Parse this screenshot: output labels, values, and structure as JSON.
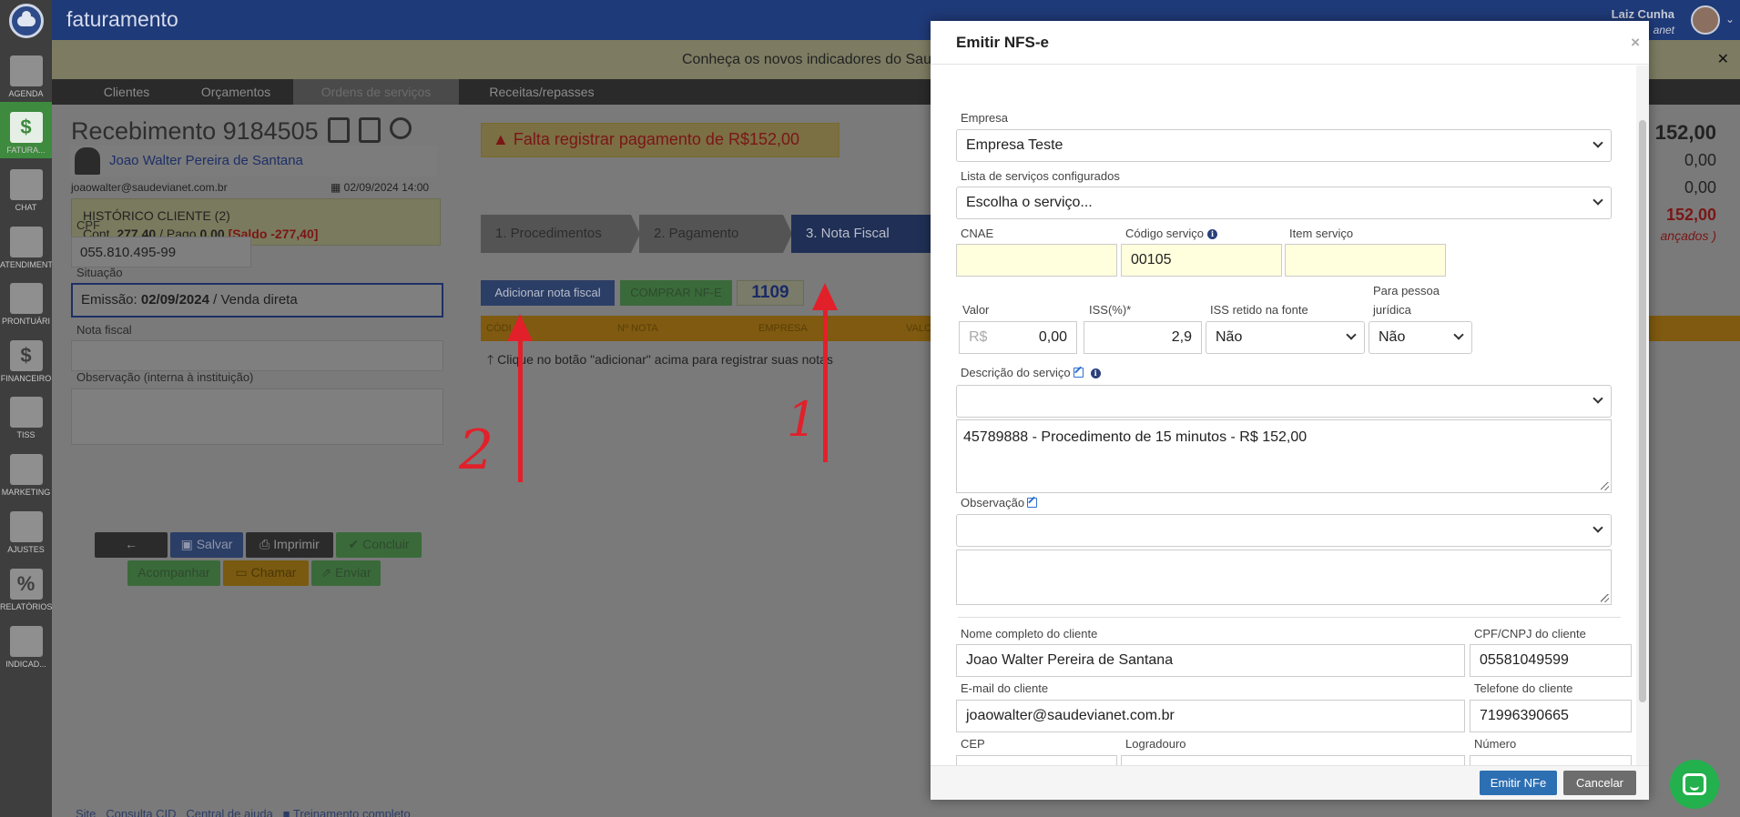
{
  "app": {
    "title": "faturamento"
  },
  "user": {
    "name": "Laiz Cunha",
    "org": "anet"
  },
  "sidebar": {
    "items": [
      {
        "label": "AGENDA"
      },
      {
        "label": "FATURA...",
        "glyph": "$"
      },
      {
        "label": "CHAT"
      },
      {
        "label": "ATENDIMENT"
      },
      {
        "label": "PRONTUÁRI"
      },
      {
        "label": "FINANCEIRO",
        "glyph": "$"
      },
      {
        "label": "TISS"
      },
      {
        "label": "MARKETING"
      },
      {
        "label": "AJUSTES"
      },
      {
        "label": "RELATÓRIOS",
        "glyph": "%"
      },
      {
        "label": "INDICAD..."
      }
    ]
  },
  "announcement": {
    "text": "Conheça os novos indicadores do Saude",
    "close": "✕"
  },
  "subnav": {
    "tabs": [
      "Clientes",
      "Orçamentos",
      "Ordens de serviços",
      "Receitas/repasses"
    ]
  },
  "receipt": {
    "title": "Recebimento 9184505",
    "patient_name": "Joao Walter Pereira de Santana",
    "patient_email": "joaowalter@saudevianet.com.br",
    "date": "02/09/2024 14:00",
    "history_title": "HISTÓRICO CLIENTE (2)",
    "history_cont_label": "Cont.",
    "history_cont_value": "277,40",
    "history_paid_label": "/ Pago",
    "history_paid_value": "0,00",
    "history_balance": "[Saldo -277,40]",
    "cpf_label": "CPF",
    "cpf_value": "055.810.495-99",
    "situation_label": "Situação",
    "situation_prefix": "Emissão:",
    "situation_date": "02/09/2024",
    "situation_suffix": "/ Venda direta",
    "nota_label": "Nota fiscal",
    "obs_label": "Observação (interna à instituição)",
    "buttons": {
      "back": "←",
      "save": "Salvar",
      "print": "Imprimir",
      "conclude": "Concluir",
      "follow": "Acompanhar",
      "call": "Chamar",
      "send": "Enviar"
    }
  },
  "warning": "Falta registrar pagamento de R$152,00",
  "steps": [
    "1. Procedimentos",
    "2. Pagamento",
    "3. Nota Fiscal"
  ],
  "nf": {
    "add_button": "Adicionar nota fiscal",
    "buy_button": "COMPRAR NF-E",
    "count": "1109",
    "columns": [
      "CÓDI",
      "Nº NOTA",
      "EMPRESA",
      "VALO"
    ],
    "hint": "Clique no botão \"adicionar\" acima para registrar suas notas"
  },
  "totals": {
    "total": "152,00",
    "line2": "0,00",
    "line3": "0,00",
    "line4": "152,00",
    "line5": "ançados )"
  },
  "footer_links": [
    "Site",
    "Consulta CID",
    "Central de ajuda",
    "Treinamento completo"
  ],
  "annotations": [
    "1",
    "2"
  ],
  "modal": {
    "title": "Emitir NFS-e",
    "close": "×",
    "empresa_label": "Empresa",
    "empresa_value": "Empresa Teste",
    "servicos_label": "Lista de serviços configurados",
    "servicos_value": "Escolha o serviço...",
    "cnae_label": "CNAE",
    "cnae_value": "",
    "codigo_label": "Código serviço",
    "codigo_value": "00105",
    "item_label": "Item serviço",
    "item_value": "",
    "valor_label": "Valor",
    "valor_prefix": "R$",
    "valor_value": "0,00",
    "iss_label": "ISS(%)*",
    "iss_value": "2,9",
    "iss_retido_label": "ISS retido na fonte",
    "iss_retido_value": "Não",
    "pj_label_1": "Para pessoa",
    "pj_label_2": "jurídica",
    "pj_value": "Não",
    "descricao_label": "Descrição do serviço",
    "descricao_select": "",
    "descricao_text": "45789888 - Procedimento de 15 minutos - R$ 152,00",
    "obs_label": "Observação",
    "obs_select": "",
    "obs_text": "",
    "cliente_nome_label": "Nome completo do cliente",
    "cliente_nome_value": "Joao Walter Pereira de Santana",
    "cliente_cpf_label": "CPF/CNPJ do cliente",
    "cliente_cpf_value": "05581049599",
    "cliente_email_label": "E-mail do cliente",
    "cliente_email_value": "joaowalter@saudevianet.com.br",
    "cliente_tel_label": "Telefone do cliente",
    "cliente_tel_value": "71996390665",
    "cep_label": "CEP",
    "logradouro_label": "Logradouro",
    "numero_label": "Número",
    "emit_button": "Emitir NFe",
    "cancel_button": "Cancelar"
  },
  "colors": {
    "topbar": "#1f3a78",
    "primary_button": "#2d6fb3",
    "annotation_red": "#e2202a",
    "chat_green": "#23b14d"
  }
}
